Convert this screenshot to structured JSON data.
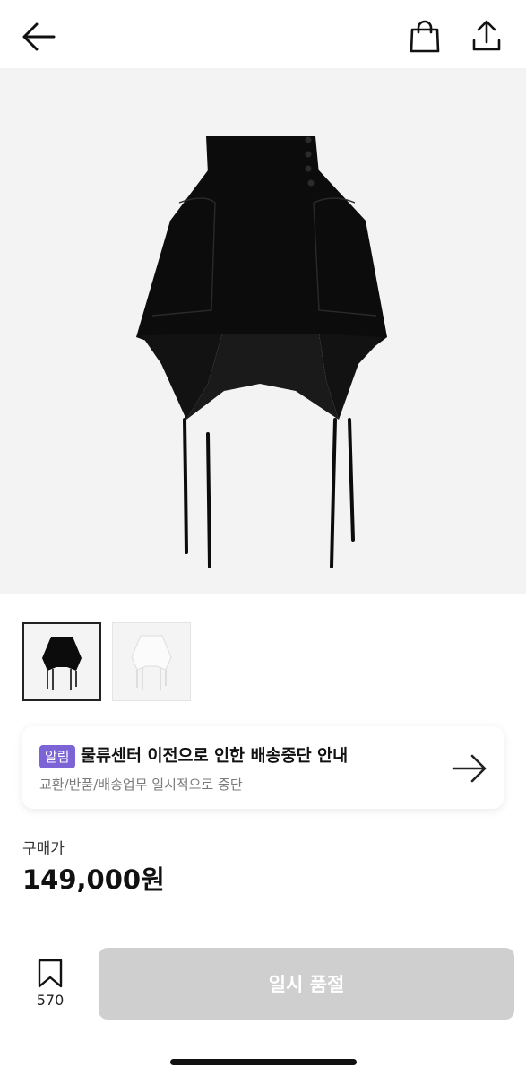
{
  "header": {
    "back_icon": "arrow-left-icon",
    "cart_icon": "shopping-bag-icon",
    "share_icon": "share-upload-icon"
  },
  "product": {
    "image_color": "#0c0c0c",
    "thumbnails": [
      {
        "variant": "black",
        "color": "#0c0c0c",
        "selected": true
      },
      {
        "variant": "white",
        "color": "#f7f7f7",
        "selected": false
      }
    ]
  },
  "notice": {
    "badge": "알림",
    "badge_color": "#7c63d6",
    "title": "물류센터 이전으로 인한 배송중단 안내",
    "subtitle": "교환/반품/배송업무 일시적으로 중단",
    "arrow_icon": "arrow-right-icon"
  },
  "pricing": {
    "label": "구매가",
    "price": "149,000원"
  },
  "bottom_bar": {
    "bookmark_icon": "bookmark-icon",
    "bookmark_count": "570",
    "soldout_label": "일시 품절",
    "soldout_color": "#cfcfcf"
  }
}
